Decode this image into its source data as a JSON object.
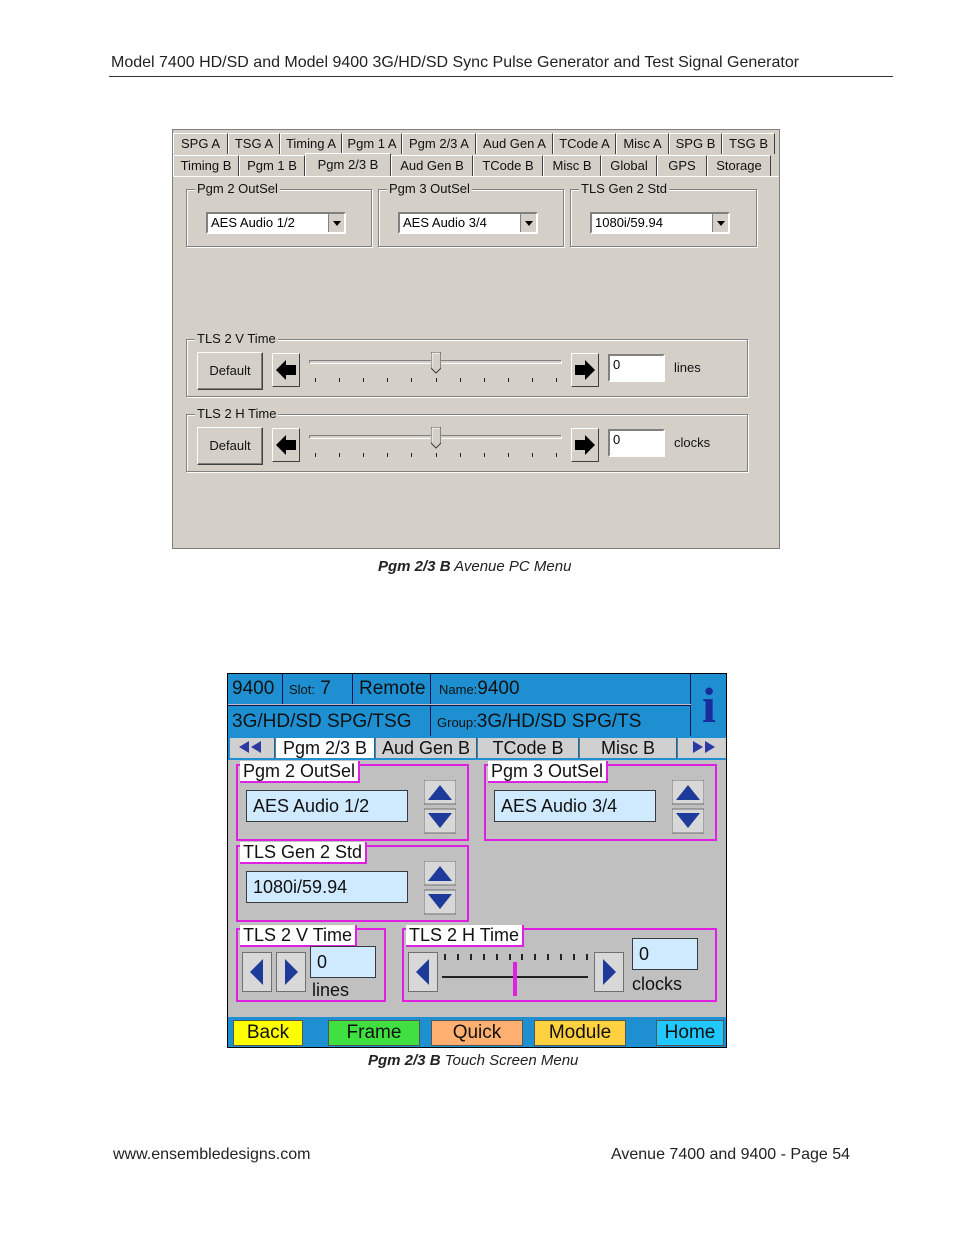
{
  "header": {
    "title": "Model 7400 HD/SD and Model 9400 3G/HD/SD Sync Pulse Generator and Test Signal Generator"
  },
  "pc_menu": {
    "tabs_row1": [
      "SPG A",
      "TSG A",
      "Timing A",
      "Pgm 1 A",
      "Pgm 2/3 A",
      "Aud Gen A",
      "TCode A",
      "Misc A",
      "SPG B",
      "TSG B"
    ],
    "tabs_row2": [
      "Timing B",
      "Pgm 1 B",
      "Pgm 2/3 B",
      "Aud Gen B",
      "TCode B",
      "Misc B",
      "Global",
      "GPS",
      "Storage"
    ],
    "active_tab": "Pgm 2/3 B",
    "pgm2_outsel": {
      "label": "Pgm 2 OutSel",
      "value": "AES Audio 1/2"
    },
    "pgm3_outsel": {
      "label": "Pgm 3 OutSel",
      "value": "AES Audio 3/4"
    },
    "tls_gen2_std": {
      "label": "TLS Gen 2 Std",
      "value": "1080i/59.94"
    },
    "tls2_v_time": {
      "label": "TLS 2 V Time",
      "default_label": "Default",
      "value": "0",
      "unit": "lines",
      "slider_fraction": 0.5
    },
    "tls2_h_time": {
      "label": "TLS 2 H Time",
      "default_label": "Default",
      "value": "0",
      "unit": "clocks",
      "slider_fraction": 0.5
    }
  },
  "captions": {
    "pc": {
      "bold": "Pgm 2/3 B",
      "rest": " Avenue PC Menu"
    },
    "touch": {
      "bold": "Pgm 2/3 B",
      "rest": " Touch Screen Menu"
    }
  },
  "touch_menu": {
    "model": "9400",
    "slot_label": "Slot:",
    "slot_value": "7",
    "mode": "Remote",
    "name_label": "Name:",
    "name_value": "9400",
    "type": "3G/HD/SD SPG/TSG",
    "group_label": "Group:",
    "group_value": "3G/HD/SD SPG/TS",
    "info_icon": "i",
    "tabs": [
      "Pgm 2/3 B",
      "Aud Gen B",
      "TCode B",
      "Misc B"
    ],
    "pgm2_outsel": {
      "label": "Pgm 2 OutSel",
      "value": "AES Audio 1/2"
    },
    "pgm3_outsel": {
      "label": "Pgm 3 OutSel",
      "value": "AES Audio 3/4"
    },
    "tls_gen2_std": {
      "label": "TLS Gen 2 Std",
      "value": "1080i/59.94"
    },
    "tls2_v_time": {
      "label": "TLS 2 V Time",
      "value": "0",
      "unit": "lines"
    },
    "tls2_h_time": {
      "label": "TLS 2 H Time",
      "value": "0",
      "unit": "clocks",
      "slider_fraction": 0.5
    },
    "buttons": {
      "back": "Back",
      "frame": "Frame",
      "quick": "Quick",
      "module": "Module",
      "home": "Home"
    },
    "colors": {
      "header_blue": "#1e90d2",
      "frame_magenta": "#e020e0",
      "back": "#ffff00",
      "frame": "#40e040",
      "quick": "#ffb070",
      "module": "#ffd040",
      "home": "#20c8ff"
    }
  },
  "footer": {
    "left": "www.ensembledesigns.com",
    "right": "Avenue 7400 and 9400 - Page 54"
  }
}
